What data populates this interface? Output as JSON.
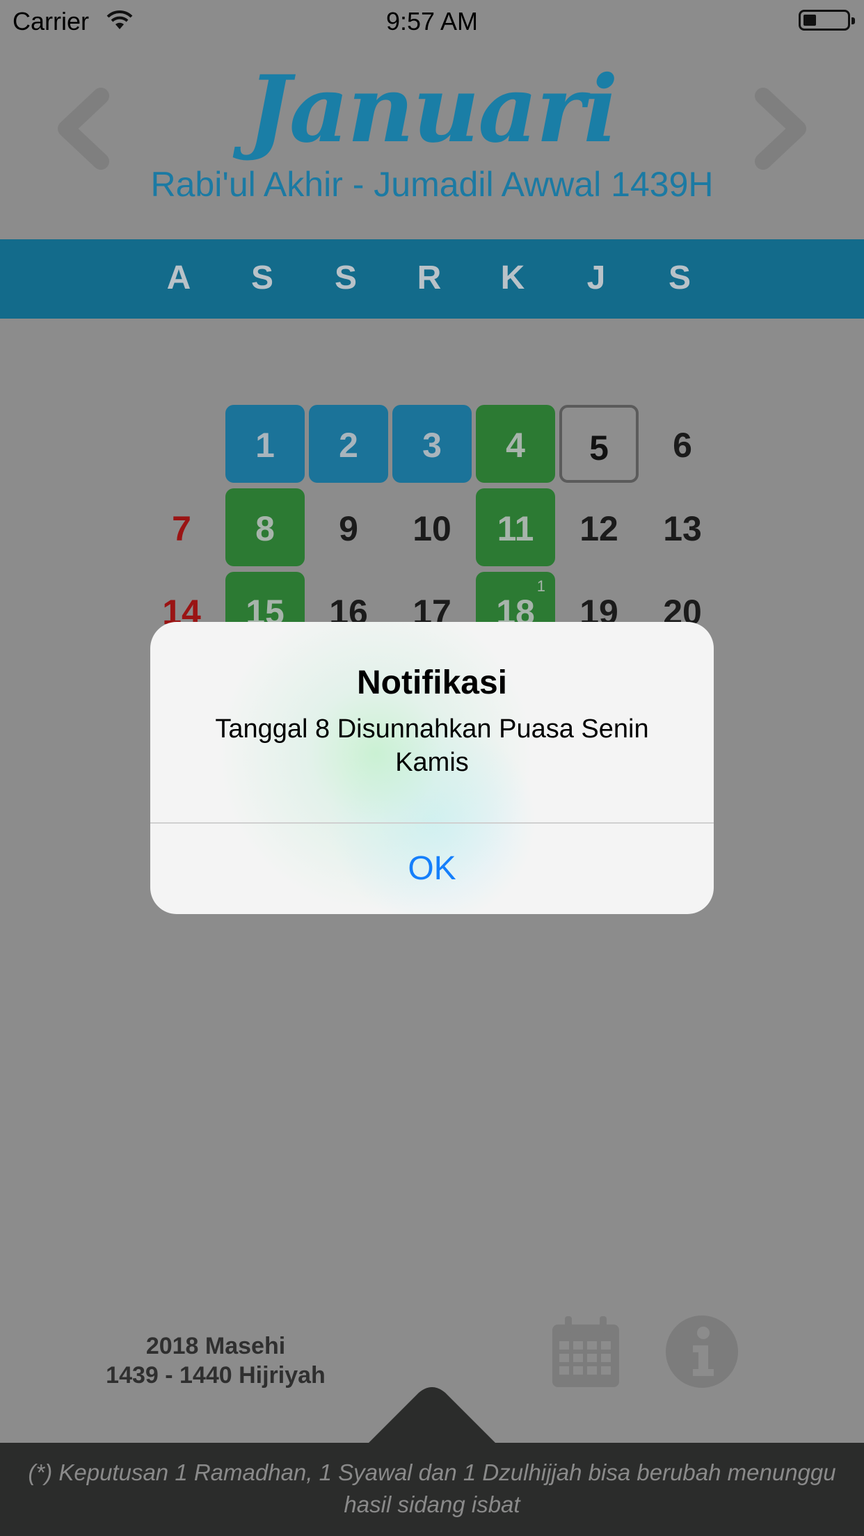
{
  "status_bar": {
    "carrier": "Carrier",
    "time": "9:57 AM"
  },
  "header": {
    "month": "Januari",
    "hijri_range": "Rabi'ul Akhir - Jumadil Awwal 1439H"
  },
  "weekdays": [
    "A",
    "S",
    "S",
    "R",
    "K",
    "J",
    "S"
  ],
  "days": {
    "row1": [
      "1",
      "2",
      "3",
      "4",
      "5",
      "6"
    ],
    "row2": [
      "7",
      "8",
      "9",
      "10",
      "11",
      "12",
      "13"
    ],
    "row3": [
      "14",
      "15",
      "16",
      "17",
      "18",
      "19",
      "20"
    ],
    "row3_badge": "1"
  },
  "alert": {
    "title": "Notifikasi",
    "message": "Tanggal 8 Disunnahkan Puasa Senin Kamis",
    "ok_label": "OK"
  },
  "footer": {
    "year_masehi": "2018 Masehi",
    "year_hijriyah": "1439 - 1440 Hijriyah",
    "note": "(*) Keputusan 1 Ramadhan, 1 Syawal dan 1 Dzulhijjah bisa berubah menunggu hasil sidang isbat"
  },
  "colors": {
    "accent_blue": "#1b7399",
    "green_marked": "#2c7a33",
    "sunday_red": "#9a1414",
    "ios_blue": "#157ffb"
  },
  "icons": [
    "wifi-icon",
    "battery-icon",
    "chevron-left-icon",
    "chevron-right-icon",
    "calendar-icon",
    "info-icon"
  ]
}
